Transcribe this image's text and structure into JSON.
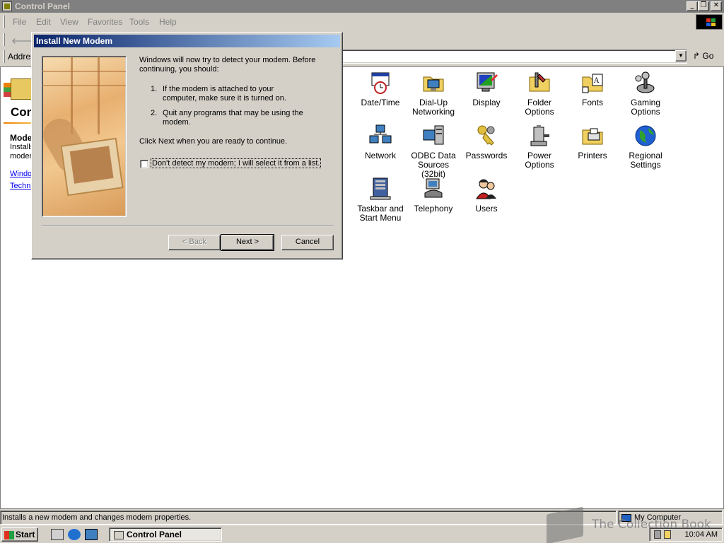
{
  "window": {
    "title": "Control Panel",
    "controls": {
      "minimize": "_",
      "restore": "❐",
      "close": "✕"
    }
  },
  "menu": [
    "File",
    "Edit",
    "View",
    "Favorites",
    "Tools",
    "Help"
  ],
  "toolbar": {
    "back_label": "B"
  },
  "address": {
    "label": "Addres",
    "go_label": "Go"
  },
  "left_pane": {
    "title": "Con",
    "selected_name": "Mode",
    "selected_desc_lines": [
      "Installs",
      "modem"
    ],
    "links": [
      "Windo",
      "Techni"
    ]
  },
  "items": [
    {
      "label": "Date/Time",
      "icon": "date-time-icon"
    },
    {
      "label": "Dial-Up Networking",
      "icon": "dial-up-networking-icon"
    },
    {
      "label": "Display",
      "icon": "display-icon"
    },
    {
      "label": "Folder Options",
      "icon": "folder-options-icon"
    },
    {
      "label": "Fonts",
      "icon": "fonts-icon"
    },
    {
      "label": "Gaming Options",
      "icon": "gaming-options-icon"
    },
    {
      "label": "Network",
      "icon": "network-icon"
    },
    {
      "label": "ODBC Data Sources (32bit)",
      "icon": "odbc-data-sources-icon"
    },
    {
      "label": "Passwords",
      "icon": "passwords-icon"
    },
    {
      "label": "Power Options",
      "icon": "power-options-icon"
    },
    {
      "label": "Printers",
      "icon": "printers-icon"
    },
    {
      "label": "Regional Settings",
      "icon": "regional-settings-icon"
    },
    {
      "label": "Taskbar and Start Menu",
      "icon": "taskbar-start-menu-icon"
    },
    {
      "label": "Telephony",
      "icon": "telephony-icon"
    },
    {
      "label": "Users",
      "icon": "users-icon"
    }
  ],
  "status": {
    "left": "Installs a new modem and changes modem properties.",
    "right": "My Computer"
  },
  "taskbar": {
    "start": "Start",
    "task": "Control Panel",
    "clock": "10:04 AM"
  },
  "watermark": "The Collection Book",
  "dialog": {
    "title": "Install New Modem",
    "intro": [
      "Windows will now try to detect your modem.  Before",
      "continuing, you should:"
    ],
    "steps": [
      {
        "num": "1.",
        "text": [
          "If the modem is attached to your",
          "computer, make sure it is turned on."
        ]
      },
      {
        "num": "2.",
        "text": [
          "Quit any programs that may be using the",
          "modem."
        ]
      }
    ],
    "continue_text": "Click Next when you are ready to continue.",
    "checkbox_label": "Don't detect my modem; I will select it from a list.",
    "back_button": "< Back",
    "next_button": "Next >",
    "cancel_button": "Cancel"
  }
}
